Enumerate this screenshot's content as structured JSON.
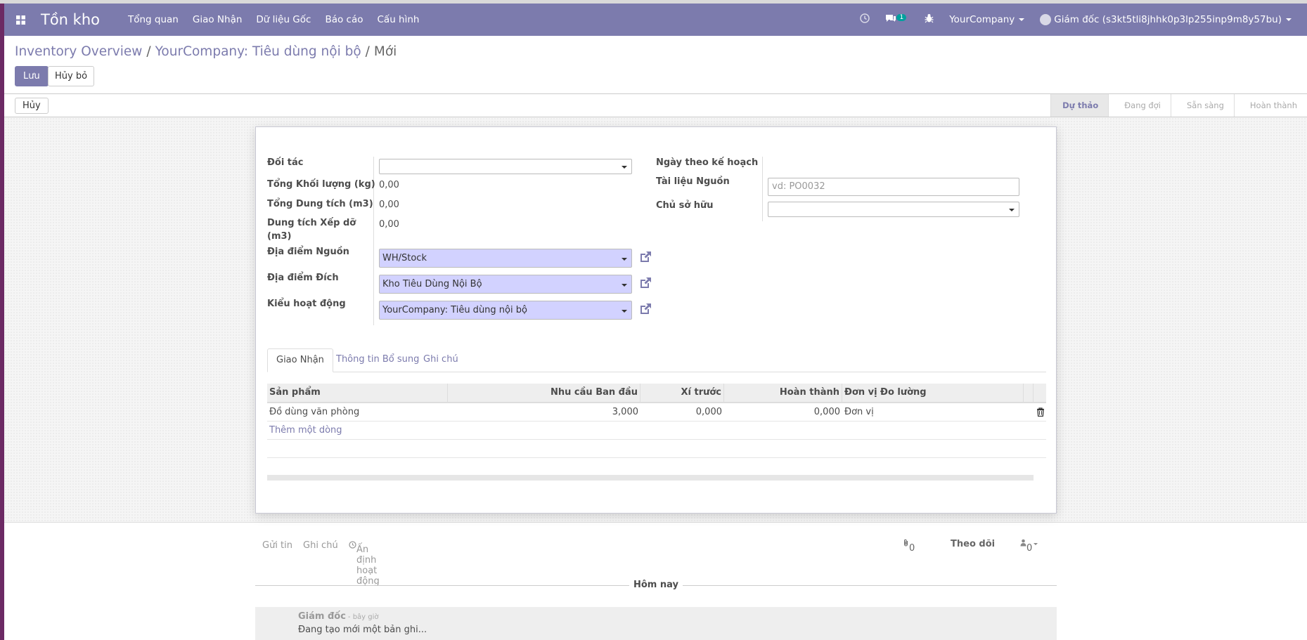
{
  "navbar": {
    "app_name": "Tồn kho",
    "menu": [
      "Tổng quan",
      "Giao Nhận",
      "Dữ liệu Gốc",
      "Báo cáo",
      "Cấu hình"
    ],
    "message_count": "1",
    "company": "YourCompany",
    "user": "Giám đốc (s3kt5tli8jhhk0p3lp255inp9m8y57bu)"
  },
  "breadcrumb": {
    "items": [
      "Inventory Overview",
      "YourCompany: Tiêu dùng nội bộ"
    ],
    "current": "Mới"
  },
  "buttons": {
    "save": "Lưu",
    "discard": "Hủy bỏ",
    "cancel": "Hủy"
  },
  "stages": [
    "Dự thảo",
    "Đang đợi",
    "Sẵn sàng",
    "Hoàn thành"
  ],
  "form": {
    "partner_label": "Đối tác",
    "partner_value": "",
    "weight_label": "Tổng Khối lượng (kg)",
    "weight_value": "0,00",
    "volume_label": "Tổng Dung tích (m3)",
    "volume_value": "0,00",
    "loading_label_line1": "Dung tích Xếp dỡ",
    "loading_label_line2": "(m3)",
    "loading_value": "0,00",
    "source_loc_label": "Địa điểm Nguồn",
    "source_loc_value": "WH/Stock",
    "dest_loc_label": "Địa điểm Đích",
    "dest_loc_value": "Kho Tiêu Dùng Nội Bộ",
    "op_type_label": "Kiểu hoạt động",
    "op_type_value": "YourCompany: Tiêu dùng nội bộ",
    "scheduled_label": "Ngày theo kế hoạch",
    "origin_label": "Tài liệu Nguồn",
    "origin_placeholder": "vd: PO0032",
    "owner_label": "Chủ sở hữu"
  },
  "tabs": [
    "Giao Nhận",
    "Thông tin Bổ sung",
    "Ghi chú"
  ],
  "table": {
    "headers": [
      "Sản phẩm",
      "Nhu cầu Ban đầu",
      "Xí trước",
      "Hoàn thành",
      "Đơn vị Đo lường"
    ],
    "rows": [
      {
        "product": "Đồ dùng văn phòng",
        "demand": "3,000",
        "reserved": "0,000",
        "done": "0,000",
        "uom": "Đơn vị"
      }
    ],
    "add_line": "Thêm một dòng"
  },
  "chatter": {
    "send_message": "Gửi tin",
    "log_note": "Ghi chú",
    "schedule_activity": "Ấn định hoạt động",
    "attachments": "0",
    "follow": "Theo dõi",
    "followers": "0",
    "today": "Hôm nay",
    "author": "Giám đốc",
    "time": "- bây giờ",
    "message": "Đang tạo mới một bản ghi..."
  }
}
